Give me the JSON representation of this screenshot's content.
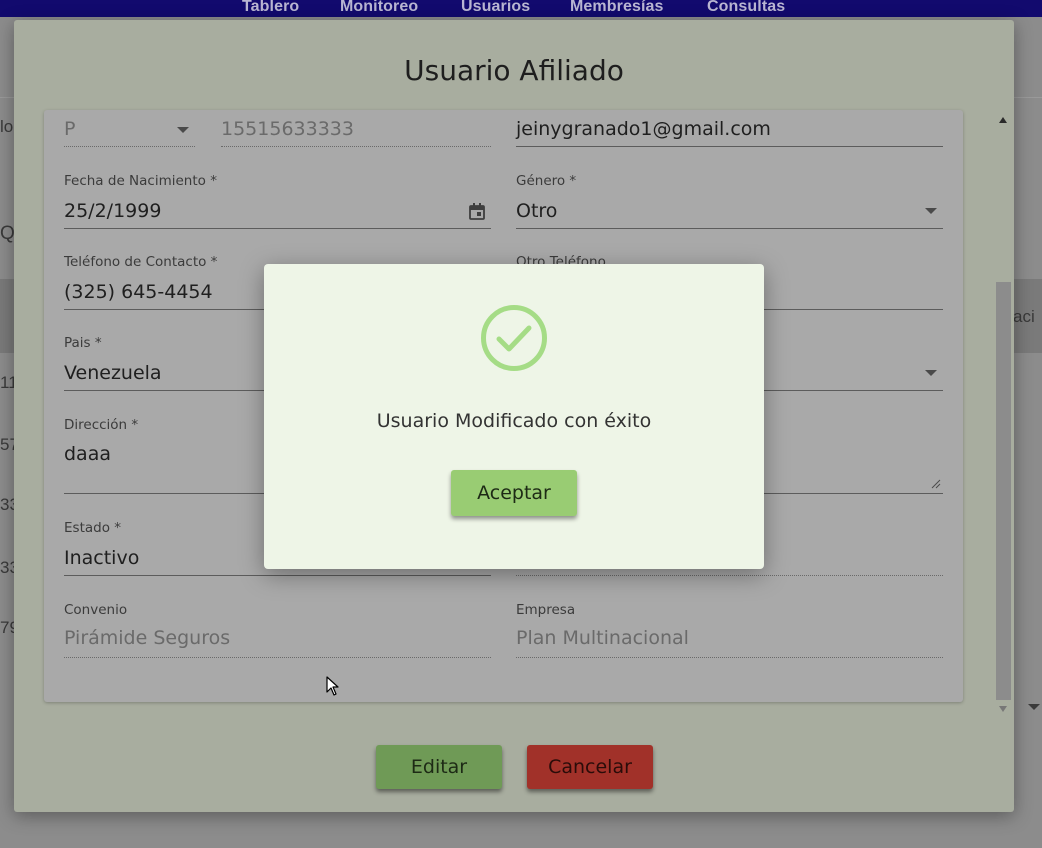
{
  "nav": {
    "items": [
      "Tablero",
      "Monitoreo",
      "Usuarios",
      "Membresías",
      "Consultas"
    ]
  },
  "background": {
    "fragments": [
      "lo",
      "Q",
      "aci",
      "11",
      "57",
      "33",
      "33",
      "79"
    ]
  },
  "dialog": {
    "title": "Usuario Afiliado",
    "form": {
      "doc_type": "P",
      "doc_number": "15515633333",
      "email": "jeinygranado1@gmail.com",
      "birth_date": {
        "label": "Fecha de Nacimiento *",
        "value": "25/2/1999"
      },
      "gender": {
        "label": "Género *",
        "value": "Otro"
      },
      "phone": {
        "label": "Teléfono de Contacto *",
        "value": "(325) 645-4454"
      },
      "other_phone": {
        "label": "Otro Teléfono",
        "value": ""
      },
      "country": {
        "label": "Pais *",
        "value": "Venezuela"
      },
      "address": {
        "label": "Dirección *",
        "value": "daaa"
      },
      "status": {
        "label": "Estado *",
        "value": "Inactivo"
      },
      "agreement": {
        "label": "Convenio",
        "value": "Pirámide Seguros"
      },
      "company": {
        "label": "Empresa",
        "value": "Plan Multinacional"
      }
    },
    "buttons": {
      "edit": "Editar",
      "cancel": "Cancelar"
    }
  },
  "alert": {
    "message": "Usuario Modificado con éxito",
    "button": "Aceptar",
    "icon": "check-circle-icon",
    "color": "#a5dc86"
  },
  "colors": {
    "nav_bg": "#120a6e",
    "edit_button": "#6f9a56",
    "cancel_button": "#a13129",
    "alert_button": "#99cc73"
  }
}
